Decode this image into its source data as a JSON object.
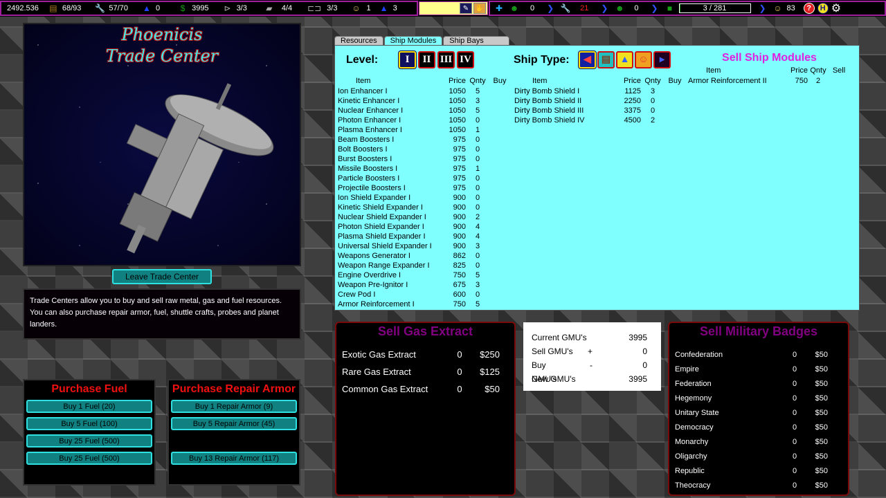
{
  "topbar": {
    "credits": "2492.536",
    "cargo": "68/93",
    "repair": "57/70",
    "fuel": "0",
    "money": "3995",
    "shuttles": "3/3",
    "landers": "4/4",
    "probes": "3/3",
    "crew": "1",
    "flasks": "3",
    "medical_count": "0",
    "repair_alerts": "21",
    "crew_alerts": "0",
    "storage_progress": "3 / 281",
    "storage_fraction": 0.0107,
    "population": "83",
    "icons": {
      "cargo": "cargo-icon",
      "repair": "wrench-icon",
      "fuel": "fuel-flask-icon",
      "money": "dollar-icon",
      "shuttle": "shuttle-icon",
      "lander": "lander-icon",
      "probe": "probe-icon",
      "crew": "crew-icon",
      "flask": "flask-icon",
      "help": "help-icon",
      "home": "h-icon",
      "settings": "gear-icon"
    }
  },
  "scene": {
    "title_line1": "Phoenicis",
    "title_line2": "Trade Center"
  },
  "leave_button": "Leave Trade Center",
  "description": "Trade Centers allow you to buy and sell raw metal, gas and fuel resources. You can also purchase repair armor, fuel, shuttle crafts, probes and planet landers.",
  "fuel_panel": {
    "title": "Purchase Fuel",
    "buttons": [
      "Buy 1 Fuel (20)",
      "Buy 5 Fuel (100)",
      "Buy 25 Fuel (500)",
      "Buy 25 Fuel (500)"
    ]
  },
  "armor_panel": {
    "title": "Purchase Repair Armor",
    "buttons": [
      "Buy 1 Repair Armor (9)",
      "Buy 5 Repair Armor (45)",
      "Buy 13 Repair Armor (117)"
    ]
  },
  "tabs": [
    "Resources",
    "Ship Modules",
    "Ship Bays"
  ],
  "active_tab": "Ship Modules",
  "modules": {
    "level_label": "Level:",
    "levels": [
      "I",
      "II",
      "III",
      "IV"
    ],
    "selected_level": "I",
    "ship_type_label": "Ship Type:",
    "ship_types": [
      "fighter-icon",
      "cargo-ship-icon",
      "science-ship-icon",
      "colony-ship-icon",
      "fleet-icon"
    ],
    "selected_ship_type": "fighter-icon",
    "headers": {
      "item": "Item",
      "price": "Price",
      "qnty": "Qnty",
      "buy": "Buy",
      "sell": "Sell"
    },
    "list_left": [
      {
        "item": "Ion Enhancer I",
        "price": "1050",
        "qnty": "5"
      },
      {
        "item": "Kinetic Enhancer I",
        "price": "1050",
        "qnty": "3"
      },
      {
        "item": "Nuclear Enhancer I",
        "price": "1050",
        "qnty": "5"
      },
      {
        "item": "Photon Enhancer I",
        "price": "1050",
        "qnty": "0"
      },
      {
        "item": "Plasma Enhancer I",
        "price": "1050",
        "qnty": "1"
      },
      {
        "item": "Beam Boosters I",
        "price": "975",
        "qnty": "0"
      },
      {
        "item": "Bolt Boosters I",
        "price": "975",
        "qnty": "0"
      },
      {
        "item": "Burst Boosters I",
        "price": "975",
        "qnty": "0"
      },
      {
        "item": "Missile Boosters I",
        "price": "975",
        "qnty": "1"
      },
      {
        "item": "Particle Boosters I",
        "price": "975",
        "qnty": "0"
      },
      {
        "item": "Projectile Boosters I",
        "price": "975",
        "qnty": "0"
      },
      {
        "item": "Ion Shield Expander I",
        "price": "900",
        "qnty": "0"
      },
      {
        "item": "Kinetic Shield Expander I",
        "price": "900",
        "qnty": "0"
      },
      {
        "item": "Nuclear Shield Expander I",
        "price": "900",
        "qnty": "2"
      },
      {
        "item": "Photon Shield Expander I",
        "price": "900",
        "qnty": "4"
      },
      {
        "item": "Plasma Shield Expander I",
        "price": "900",
        "qnty": "4"
      },
      {
        "item": "Universal Shield Expander I",
        "price": "900",
        "qnty": "3"
      },
      {
        "item": "Weapons Generator I",
        "price": "862",
        "qnty": "0"
      },
      {
        "item": "Weapon Range Expander I",
        "price": "825",
        "qnty": "0"
      },
      {
        "item": "Engine Overdrive I",
        "price": "750",
        "qnty": "5"
      },
      {
        "item": "Weapon Pre-Ignitor I",
        "price": "675",
        "qnty": "3"
      },
      {
        "item": "Crew Pod I",
        "price": "600",
        "qnty": "0"
      },
      {
        "item": "Armor Reinforcement I",
        "price": "750",
        "qnty": "5"
      }
    ],
    "list_mid": [
      {
        "item": "Dirty Bomb Shield I",
        "price": "1125",
        "qnty": "3"
      },
      {
        "item": "Dirty Bomb Shield II",
        "price": "2250",
        "qnty": "0"
      },
      {
        "item": "Dirty Bomb Shield III",
        "price": "3375",
        "qnty": "0"
      },
      {
        "item": "Dirty Bomb Shield IV",
        "price": "4500",
        "qnty": "2"
      }
    ],
    "sell_title": "Sell Ship Modules",
    "sell_list": [
      {
        "item": "Armor Reinforcement II",
        "price": "750",
        "qnty": "2"
      }
    ]
  },
  "gas": {
    "title": "Sell Gas Extract",
    "rows": [
      {
        "name": "Exotic Gas Extract",
        "qnty": "0",
        "price": "$250"
      },
      {
        "name": "Rare Gas Extract",
        "qnty": "0",
        "price": "$125"
      },
      {
        "name": "Common Gas Extract",
        "qnty": "0",
        "price": "$50"
      }
    ]
  },
  "gmu": {
    "current_label": "Current GMU's",
    "current": "3995",
    "sell_label": "Sell GMU's",
    "sell_op": "+",
    "sell": "0",
    "buy_label": "Buy GMU's",
    "buy_op": "-",
    "buy": "0",
    "new_label": "New GMU's",
    "new": "3995"
  },
  "badges": {
    "title": "Sell Military Badges",
    "rows": [
      {
        "name": "Confederation",
        "qnty": "0",
        "price": "$50"
      },
      {
        "name": "Empire",
        "qnty": "0",
        "price": "$50"
      },
      {
        "name": "Federation",
        "qnty": "0",
        "price": "$50"
      },
      {
        "name": "Hegemony",
        "qnty": "0",
        "price": "$50"
      },
      {
        "name": "Unitary State",
        "qnty": "0",
        "price": "$50"
      },
      {
        "name": "Democracy",
        "qnty": "0",
        "price": "$50"
      },
      {
        "name": "Monarchy",
        "qnty": "0",
        "price": "$50"
      },
      {
        "name": "Oligarchy",
        "qnty": "0",
        "price": "$50"
      },
      {
        "name": "Republic",
        "qnty": "0",
        "price": "$50"
      },
      {
        "name": "Theocracy",
        "qnty": "0",
        "price": "$50"
      }
    ]
  }
}
